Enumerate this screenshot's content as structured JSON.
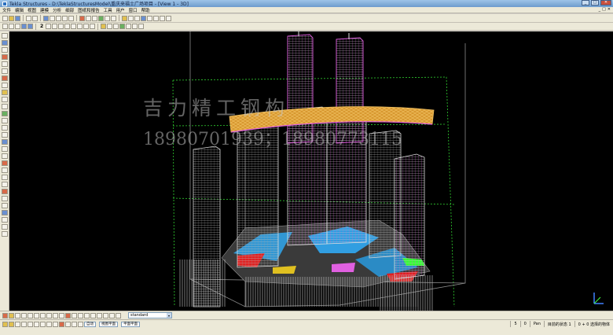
{
  "window": {
    "title": "Tekla Structures - D:\\TeklaStructuresModel\\重庆来福士广场项目 - [View 1 - 3D]",
    "minimize": "_",
    "maximize": "□",
    "close": "✕"
  },
  "menu": {
    "items": [
      "文件",
      "编辑",
      "视图",
      "建模",
      "分析",
      "细部",
      "图纸和报告",
      "工具",
      "用户",
      "窗口",
      "帮助"
    ],
    "mdi_min": "_",
    "mdi_max": "□",
    "mdi_close": "✕"
  },
  "toolbar": {
    "number_label": "2"
  },
  "viewport": {
    "watermark_name": "吉力精工钢构",
    "watermark_phone": "18980701939；18980773115",
    "background_color": "#000000",
    "accent_colors": [
      "#e0a030",
      "#e060e0",
      "#30b0ff",
      "#e02020",
      "#d0d0d0",
      "#30ff30"
    ]
  },
  "bottom": {
    "combo_value": "standard",
    "combo_arrow": "▾",
    "snap_label_1": "自动",
    "snap_label_2": "视图平面",
    "snap_label_3": "平面平面"
  },
  "status": {
    "val_1": "5",
    "val_2": "0",
    "pan": "Pan",
    "mode": "目前的状态 1",
    "selection": "0 + 0 选择的物体"
  }
}
